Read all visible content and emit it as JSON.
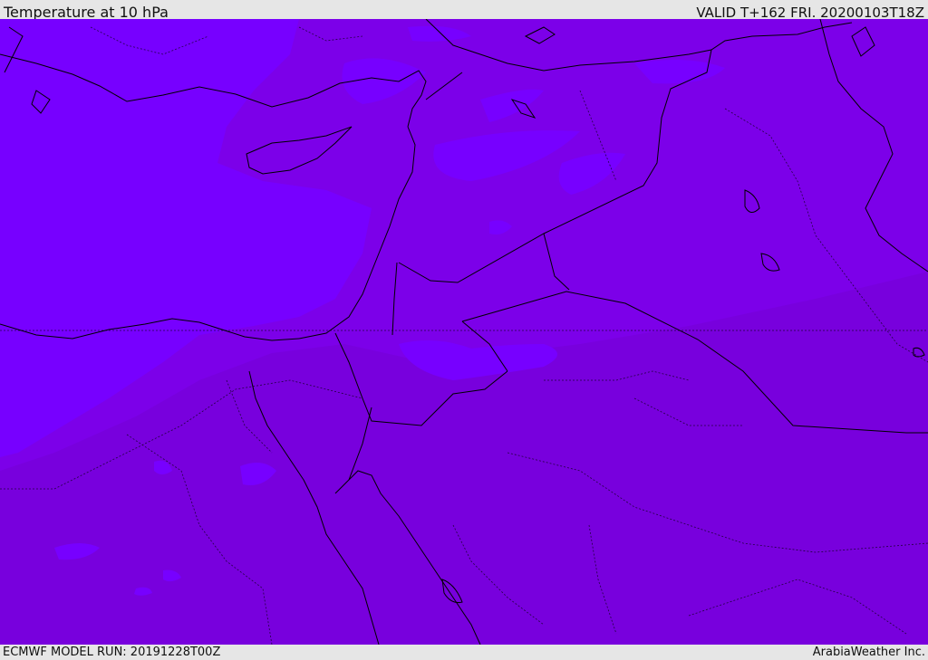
{
  "header": {
    "title": "Temperature at 10 hPa",
    "valid_time": "VALID T+162 FRI. 20200103T18Z"
  },
  "footer": {
    "model_run": "ECMWF MODEL RUN: 20191228T00Z",
    "credit": "ArabiaWeather Inc."
  },
  "colors": {
    "field_cold": "#7700ff",
    "field_mid": "#7c00e9",
    "field_warm": "#7800dd",
    "border": "#000000",
    "frame": "#e6e6e6"
  }
}
